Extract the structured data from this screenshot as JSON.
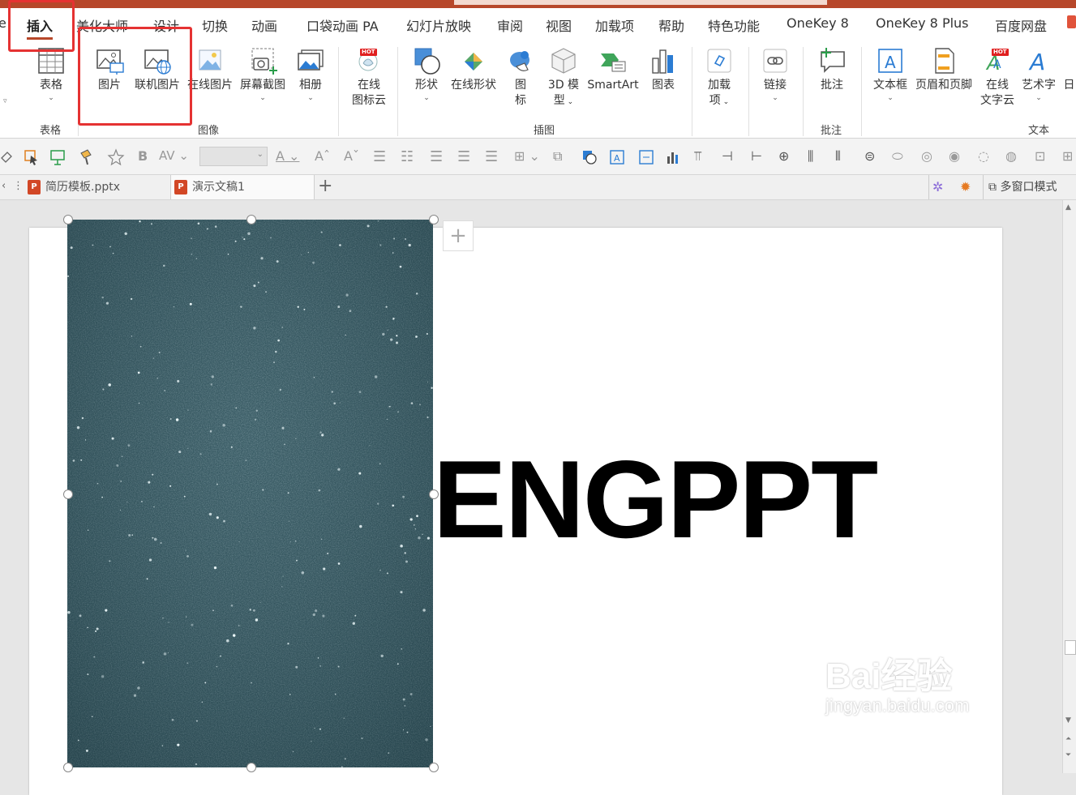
{
  "menubar": {
    "tabs": [
      {
        "label": "e"
      },
      {
        "label": "插入"
      },
      {
        "label": "美化大师"
      },
      {
        "label": "设计"
      },
      {
        "label": "切换"
      },
      {
        "label": "动画"
      },
      {
        "label": "口袋动画 PA"
      },
      {
        "label": "幻灯片放映"
      },
      {
        "label": "审阅"
      },
      {
        "label": "视图"
      },
      {
        "label": "加载项"
      },
      {
        "label": "帮助"
      },
      {
        "label": "特色功能"
      },
      {
        "label": "OneKey 8"
      },
      {
        "label": "OneKey 8 Plus"
      },
      {
        "label": "百度网盘"
      }
    ],
    "active_tab": "插入"
  },
  "ribbon": {
    "buttons": {
      "table": "表格",
      "picture": "图片",
      "online_picture": "联机图片",
      "online_pic2": "在线图片",
      "screenshot": "屏幕截图",
      "album": "相册",
      "online_icon_line1": "在线",
      "online_icon_line2": "图标云",
      "shape": "形状",
      "online_shape": "在线形状",
      "icon_line1": "图",
      "icon_line2": "标",
      "model3d_line1": "3D 模",
      "model3d_line2": "型",
      "smartart": "SmartArt",
      "chart": "图表",
      "addin_line1": "加载",
      "addin_line2": "项",
      "link": "链接",
      "comment": "批注",
      "textbox": "文本框",
      "header_footer": "页眉和页脚",
      "online_text_line1": "在线",
      "online_text_line2": "文字云",
      "wordart": "艺术字",
      "date_partial": "日"
    },
    "groups": {
      "table": "表格",
      "image": "图像",
      "illustration": "插图",
      "comment": "批注",
      "text": "文本"
    },
    "hot_badge": "HOT"
  },
  "doc_tabs": [
    {
      "label": "简历模板.pptx"
    },
    {
      "label": "演示文稿1"
    }
  ],
  "tabbar_right": {
    "multiwindow": "多窗口模式"
  },
  "slide": {
    "title_text": "ENGPPT"
  },
  "watermark": {
    "line1": "Bai经验",
    "line2": "jingyan.baidu.com"
  },
  "colors": {
    "accent": "#b7472a",
    "highlight": "#e53232",
    "photo": "#34555e"
  }
}
